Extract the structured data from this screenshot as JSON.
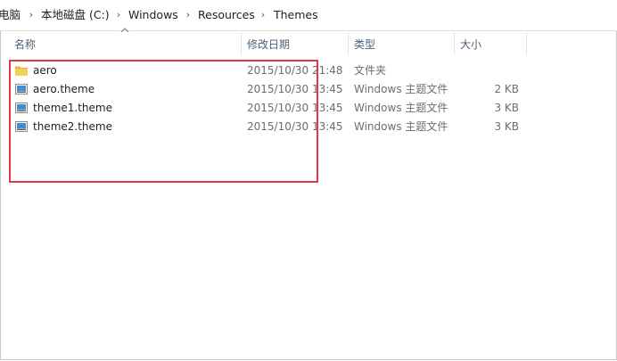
{
  "breadcrumb": {
    "items": [
      "电脑",
      "本地磁盘 (C:)",
      "Windows",
      "Resources",
      "Themes"
    ],
    "separator": "›"
  },
  "columns": {
    "name": "名称",
    "date": "修改日期",
    "type": "类型",
    "size": "大小"
  },
  "files": [
    {
      "name": "aero",
      "date": "2015/10/30 21:48",
      "type": "文件夹",
      "size": "",
      "icon": "folder-icon"
    },
    {
      "name": "aero.theme",
      "date": "2015/10/30 13:45",
      "type": "Windows 主题文件",
      "size": "2 KB",
      "icon": "theme-file-icon"
    },
    {
      "name": "theme1.theme",
      "date": "2015/10/30 13:45",
      "type": "Windows 主题文件",
      "size": "3 KB",
      "icon": "theme-file-icon"
    },
    {
      "name": "theme2.theme",
      "date": "2015/10/30 13:45",
      "type": "Windows 主题文件",
      "size": "3 KB",
      "icon": "theme-file-icon"
    }
  ],
  "colors": {
    "highlight": "#e0393f",
    "folder": "#f5cf5c",
    "header_text": "#4c607a"
  }
}
